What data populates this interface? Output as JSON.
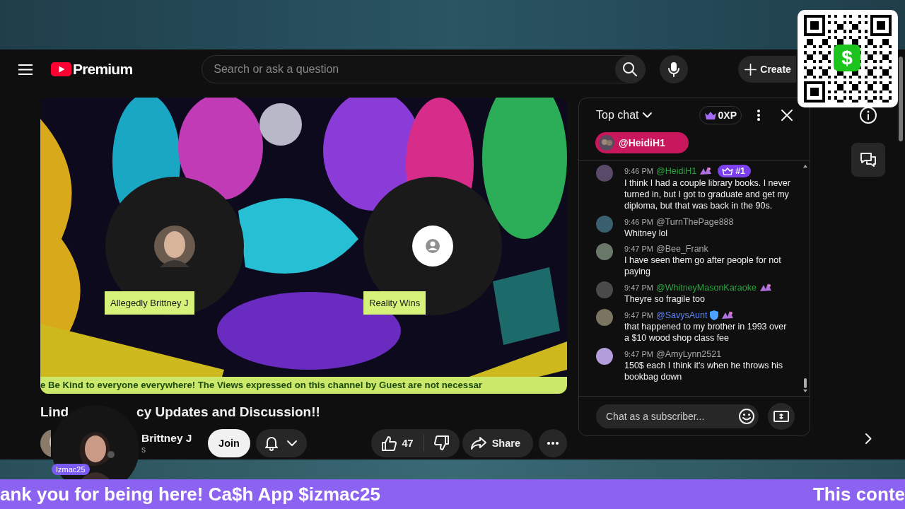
{
  "header": {
    "logo_text": "Premium",
    "search": {
      "placeholder": "Search or ask a question"
    },
    "create_button": "Create"
  },
  "video": {
    "guests": [
      {
        "name": "Allegedly Brittney J"
      },
      {
        "name": "Reality Wins",
        "kind": "default"
      }
    ],
    "ticker": "e Be Kind to everyone everywhere! The Views expressed on this channel by Guest are not necessar"
  },
  "title_parts": [
    "Lind",
    "cy Updates and Discussion!!"
  ],
  "channel": {
    "name_part": "Brittney J",
    "subscribers_part": "s",
    "join_button": "Join"
  },
  "actions": {
    "likes": "47",
    "share_button": "Share"
  },
  "chat": {
    "title": "Top chat",
    "xp": "0XP",
    "pinned_user": "@HeidiH1",
    "messages": [
      {
        "time": "9:46 PM",
        "author": "@HeidiH1",
        "color": "#2ba640",
        "sticker": true,
        "verified": false,
        "rank": "#1",
        "text": "I think I had a couple library books. I never turned in, but I got to graduate and get my diploma, but that was back in the 90s."
      },
      {
        "time": "9:46 PM",
        "author": "@TurnThePage888",
        "color": "#aaaaaa",
        "sticker": false,
        "verified": false,
        "text": "Whitney lol"
      },
      {
        "time": "9:47 PM",
        "author": "@Bee_Frank",
        "color": "#aaaaaa",
        "sticker": false,
        "verified": false,
        "text": "I have seen them go after people for not paying"
      },
      {
        "time": "9:47 PM",
        "author": "@WhitneyMasonKaraoke",
        "color": "#2ba640",
        "sticker": true,
        "verified": false,
        "text": "Theyre so fragile too"
      },
      {
        "time": "9:47 PM",
        "author": "@SavysAunt",
        "color": "#5e84f1",
        "sticker": true,
        "verified": true,
        "text": "that happened to my brother in 1993 over a $10 wood shop class fee"
      },
      {
        "time": "9:47 PM",
        "author": "@AmyLynn2521",
        "color": "#aaaaaa",
        "sticker": false,
        "verified": false,
        "text": "150$ each I think it's when he throws his bookbag down"
      }
    ],
    "input_placeholder": "Chat as a subscriber..."
  },
  "webcam": {
    "label": "Izmac25"
  },
  "qr_code": {
    "logo_glyph": "$"
  },
  "ticker_bar": {
    "texts": [
      "ank you for being here! Ca$h App $izmac25",
      "This conte"
    ]
  }
}
